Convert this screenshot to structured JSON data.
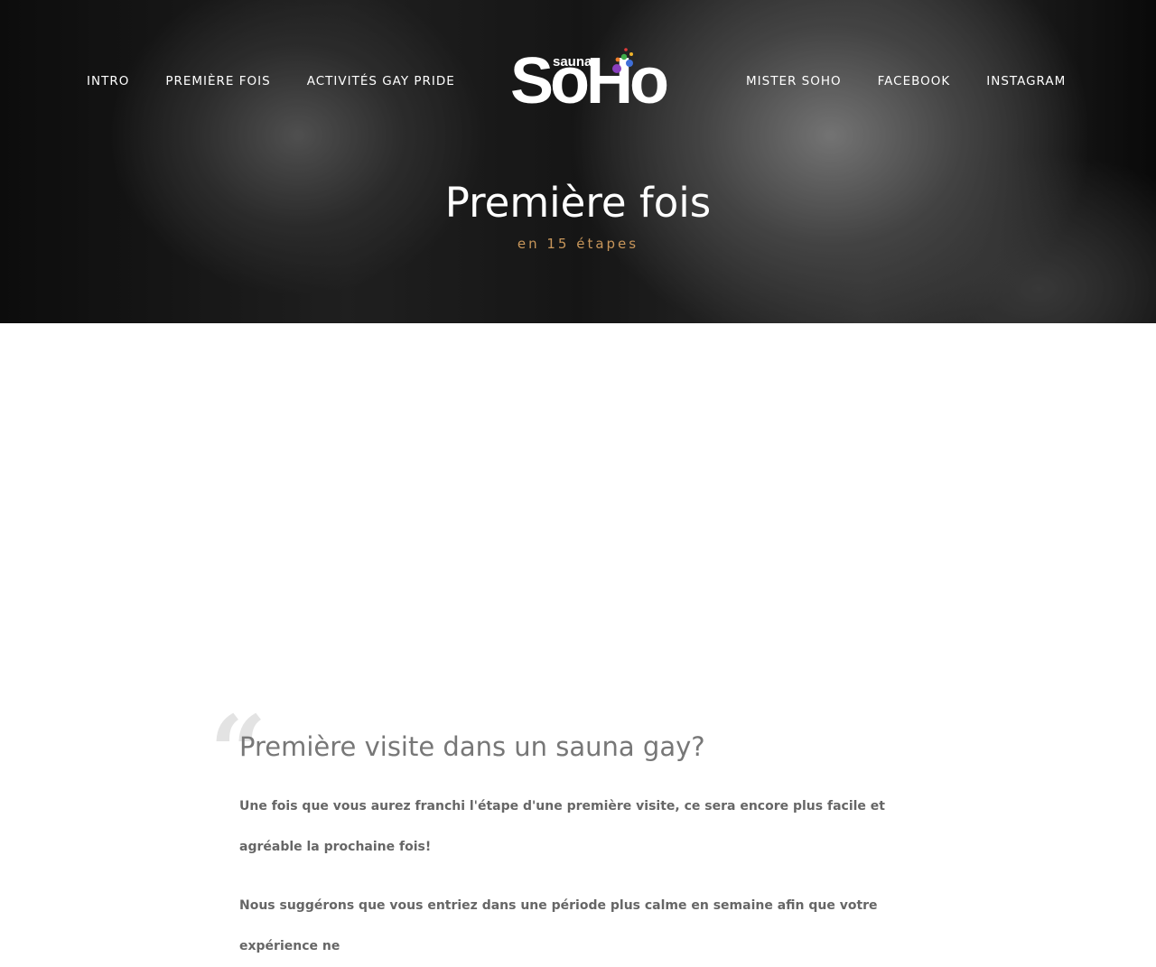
{
  "nav": {
    "left": [
      "INTRO",
      "PREMIÈRE FOIS",
      "ACTIVITÉS GAY PRIDE"
    ],
    "right": [
      "MISTER SOHO",
      "FACEBOOK",
      "INSTAGRAM"
    ]
  },
  "logo": {
    "small": "sauna",
    "main": "SoHo"
  },
  "hero": {
    "title": "Première fois",
    "subtitle": "en 15 étapes"
  },
  "content": {
    "title": "Première visite dans un sauna gay?",
    "paragraph1": "Une fois que vous aurez franchi l'étape d'une première visite, ce sera encore plus facile et agréable la prochaine fois!",
    "paragraph2": "Nous suggérons que vous entriez dans une période plus calme en semaine afin que votre expérience ne"
  },
  "colors": {
    "accent": "#c8965a"
  },
  "icons": {
    "quote": "quote-icon"
  }
}
